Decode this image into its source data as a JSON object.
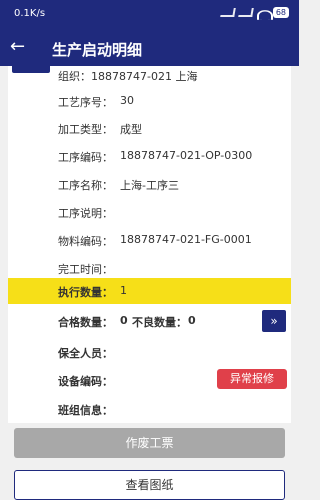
{
  "status": {
    "time": "0.1K/s",
    "battery": "68"
  },
  "header": {
    "title": "生产启动明细"
  },
  "fields": {
    "org": "组织：18878747-021 上海",
    "process_seq_label": "工艺序号：",
    "process_seq_value": "30",
    "process_type_label": "加工类型：",
    "process_type_value": "成型",
    "op_code_label": "工序编码：",
    "op_code_value": "18878747-021-OP-0300",
    "op_name_label": "工序名称：",
    "op_name_value": "上海-工序三",
    "op_desc_label": "工序说明：",
    "material_label": "物料编码：",
    "material_value": "18878747-021-FG-0001",
    "finish_time_label": "完工时间：",
    "exec_qty_label": "执行数量：",
    "exec_qty_value": "1",
    "good_qty_label": "合格数量：",
    "good_qty_value": "0",
    "bad_qty_label": "不良数量：",
    "bad_qty_value": "0",
    "maint_label": "保全人员：",
    "device_label": "设备编码：",
    "team_label": "班组信息："
  },
  "buttons": {
    "next": "»",
    "abnormal": "异常报修",
    "void": "作废工票",
    "view": "查看图纸"
  },
  "colors": {
    "primary": "#1f2a7d",
    "highlight": "#f6df18",
    "danger": "#e0404a",
    "good": "#1a8a3a"
  }
}
